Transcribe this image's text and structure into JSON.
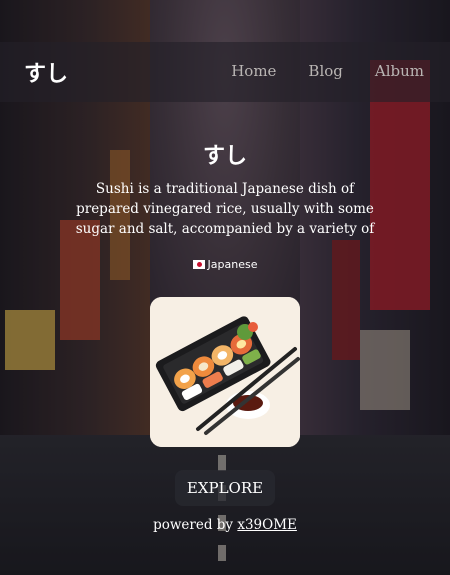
{
  "nav": {
    "brand": "すし",
    "links": [
      "Home",
      "Blog",
      "Album"
    ]
  },
  "main": {
    "title": "すし",
    "description": "Sushi is a traditional Japanese dish of prepared vinegared rice, usually with some sugar and salt, accompanied by a variety of ingredients, such as",
    "language": "Japanese",
    "explore_label": "EXPLORE"
  },
  "footer": {
    "powered_prefix": "powered by",
    "powered_link": "x39OME"
  },
  "icons": {
    "flag": "japan-flag-icon"
  },
  "colors": {
    "nav_link": "#b9b5b3",
    "card_bg": "#f6efe6"
  }
}
